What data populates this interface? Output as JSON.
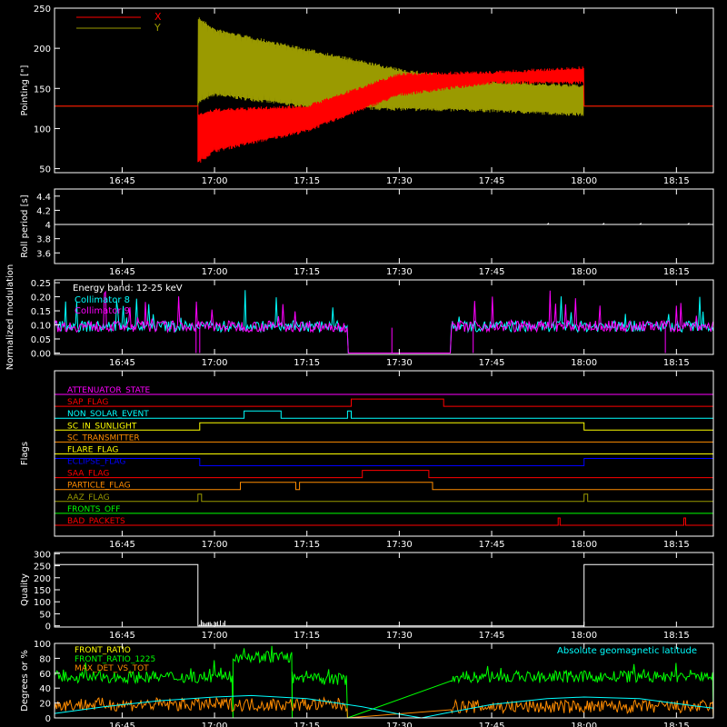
{
  "colors": {
    "bg": "#000000",
    "axis": "#ffffff",
    "red": "#ff0000",
    "olive": "#9a9a00",
    "cyan": "#00ffff",
    "magenta": "#ff00ff",
    "orange": "#ff8c00",
    "green": "#00ff00",
    "yellow": "#ffff00",
    "blue": "#0000ff",
    "white": "#ffffff"
  },
  "chart_data": [
    {
      "id": "pointing",
      "type": "line",
      "ylabel": "Pointing [\"]",
      "ylim": [
        45,
        250
      ],
      "yticks": [
        50,
        100,
        150,
        200,
        250
      ],
      "xticks": [
        "16:45",
        "17:00",
        "17:15",
        "17:30",
        "17:45",
        "18:00",
        "18:15"
      ],
      "legend": [
        "X",
        "Y"
      ],
      "series": [
        {
          "name": "X",
          "color": "red",
          "points": [
            [
              16.567,
              128
            ],
            [
              16.955,
              128
            ],
            [
              16.955,
              60
            ],
            [
              17.0,
              95
            ],
            [
              17.25,
              112
            ],
            [
              17.5,
              155
            ],
            [
              17.75,
              162
            ],
            [
              18.0,
              165
            ],
            [
              18.0,
              128
            ],
            [
              18.35,
              128
            ]
          ],
          "band": [
            [
              16.955,
              55,
              120
            ],
            [
              17.0,
              70,
              125
            ],
            [
              17.25,
              95,
              130
            ],
            [
              17.5,
              140,
              170
            ],
            [
              17.75,
              155,
              172
            ],
            [
              18.0,
              155,
              178
            ]
          ]
        },
        {
          "name": "Y",
          "color": "olive",
          "points": [
            [
              16.567,
              128
            ],
            [
              16.955,
              128
            ],
            [
              16.955,
              230
            ],
            [
              17.0,
              210
            ],
            [
              17.25,
              180
            ],
            [
              17.5,
              150
            ],
            [
              17.75,
              140
            ],
            [
              18.0,
              135
            ],
            [
              18.0,
              128
            ],
            [
              18.35,
              128
            ]
          ],
          "band": [
            [
              16.955,
              130,
              240
            ],
            [
              17.0,
              140,
              225
            ],
            [
              17.25,
              125,
              200
            ],
            [
              17.5,
              122,
              175
            ],
            [
              17.75,
              120,
              160
            ],
            [
              18.0,
              115,
              155
            ]
          ]
        }
      ]
    },
    {
      "id": "roll",
      "type": "line",
      "ylabel": "Roll period [s]",
      "ylim": [
        3.45,
        4.5
      ],
      "yticks": [
        3.6,
        3.8,
        4.0,
        4.2,
        4.4
      ],
      "xticks": [
        "16:45",
        "17:00",
        "17:15",
        "17:30",
        "17:45",
        "18:00",
        "18:15"
      ],
      "series": [
        {
          "name": "",
          "color": "white",
          "points": [
            [
              16.567,
              4.0
            ],
            [
              18.35,
              4.0
            ]
          ]
        }
      ]
    },
    {
      "id": "modulation",
      "type": "line",
      "ylabel": "Normalized modulation",
      "ylim": [
        -0.005,
        0.26
      ],
      "yticks": [
        0.0,
        0.05,
        0.1,
        0.15,
        0.2,
        0.25
      ],
      "ytick_labels": [
        "0.00",
        "0.05",
        "0.10",
        "0.15",
        "0.20",
        "0.25"
      ],
      "xticks": [
        "16:45",
        "17:00",
        "17:15",
        "17:30",
        "17:45",
        "18:00",
        "18:15"
      ],
      "annotation": "Energy band: 12-25 keV",
      "legend": [
        "Collimator 8",
        "Collimator 9"
      ],
      "series": [
        {
          "name": "Collimator 8",
          "color": "cyan",
          "level": 0.095,
          "gap": [
            17.36,
            17.64
          ]
        },
        {
          "name": "Collimator 9",
          "color": "magenta",
          "level": 0.095,
          "gap": [
            17.36,
            17.64
          ]
        }
      ]
    },
    {
      "id": "flags",
      "type": "line",
      "ylabel": "Flags",
      "xticks": [
        "16:45",
        "17:00",
        "17:15",
        "17:30",
        "17:45",
        "18:00",
        "18:15"
      ],
      "flags": [
        {
          "name": "ATTENUATOR_STATE",
          "color": "magenta",
          "on": []
        },
        {
          "name": "SAP_FLAG",
          "color": "red",
          "on": [
            [
              17.37,
              17.62
            ]
          ]
        },
        {
          "name": "NON_SOLAR_EVENT",
          "color": "cyan",
          "on": [
            [
              17.08,
              17.18
            ],
            [
              17.36,
              17.37
            ]
          ]
        },
        {
          "name": "SC_IN_SUNLIGHT",
          "color": "yellow",
          "on": [
            [
              16.96,
              18.0
            ]
          ]
        },
        {
          "name": "SC_TRANSMITTER",
          "color": "orange",
          "on": []
        },
        {
          "name": "FLARE_FLAG",
          "color": "yellow",
          "on": []
        },
        {
          "name": "ECLIPSE_FLAG",
          "color": "blue",
          "on": [
            [
              16.567,
              16.96
            ],
            [
              18.0,
              18.35
            ]
          ]
        },
        {
          "name": "SAA_FLAG",
          "color": "red",
          "on": [
            [
              17.4,
              17.58
            ]
          ]
        },
        {
          "name": "PARTICLE_FLAG",
          "color": "orange",
          "on": [
            [
              17.07,
              17.22
            ],
            [
              17.23,
              17.59
            ]
          ]
        },
        {
          "name": "AAZ_FLAG",
          "color": "olive",
          "on": [
            [
              16.955,
              16.965
            ],
            [
              18.0,
              18.01
            ]
          ]
        },
        {
          "name": "FRONTS_OFF",
          "color": "green",
          "on": []
        },
        {
          "name": "BAD_PACKETS",
          "color": "red",
          "on": [
            [
              17.93,
              17.935
            ],
            [
              18.27,
              18.275
            ]
          ]
        }
      ]
    },
    {
      "id": "quality",
      "type": "line",
      "ylabel": "Quality",
      "ylim": [
        -5,
        305
      ],
      "yticks": [
        0,
        50,
        100,
        150,
        200,
        250,
        300
      ],
      "xticks": [
        "16:45",
        "17:00",
        "17:15",
        "17:30",
        "17:45",
        "18:00",
        "18:15"
      ],
      "series": [
        {
          "name": "",
          "color": "white",
          "points": [
            [
              16.567,
              255
            ],
            [
              16.955,
              255
            ],
            [
              16.955,
              0
            ],
            [
              18.0,
              0
            ],
            [
              18.0,
              255
            ],
            [
              18.35,
              255
            ]
          ]
        }
      ]
    },
    {
      "id": "ratios",
      "type": "line",
      "ylabel": "Degrees or %",
      "ylim": [
        0,
        100
      ],
      "yticks": [
        0,
        20,
        40,
        60,
        80,
        100
      ],
      "xticks": [
        "16:45",
        "17:00",
        "17:15",
        "17:30",
        "17:45",
        "18:00",
        "18:15"
      ],
      "legend": [
        "FRONT_RATIO",
        "FRONT_RATIO_1225",
        "MAX_DET_VS_TOT"
      ],
      "annotation": "Absolute geomagnetic latitude",
      "series": [
        {
          "name": "FRONT_RATIO",
          "color": "yellow",
          "level": 20
        },
        {
          "name": "FRONT_RATIO_1225",
          "color": "green",
          "segments": [
            [
              16.567,
              17.05,
              55
            ],
            [
              17.05,
              17.21,
              82
            ],
            [
              17.21,
              17.36,
              52
            ],
            [
              17.64,
              18.35,
              55
            ]
          ]
        },
        {
          "name": "MAX_DET_VS_TOT",
          "color": "orange",
          "segments": [
            [
              16.567,
              17.36,
              18
            ],
            [
              17.64,
              18.35,
              15
            ]
          ]
        },
        {
          "name": "Absolute geomagnetic latitude",
          "color": "cyan",
          "points": [
            [
              16.567,
              6
            ],
            [
              16.7,
              15
            ],
            [
              16.85,
              23
            ],
            [
              17.0,
              28
            ],
            [
              17.1,
              30
            ],
            [
              17.25,
              26
            ],
            [
              17.4,
              15
            ],
            [
              17.5,
              5
            ],
            [
              17.56,
              0
            ],
            [
              17.62,
              6
            ],
            [
              17.75,
              18
            ],
            [
              17.9,
              26
            ],
            [
              18.0,
              28
            ],
            [
              18.15,
              26
            ],
            [
              18.3,
              16
            ],
            [
              18.35,
              13
            ]
          ]
        }
      ]
    }
  ]
}
